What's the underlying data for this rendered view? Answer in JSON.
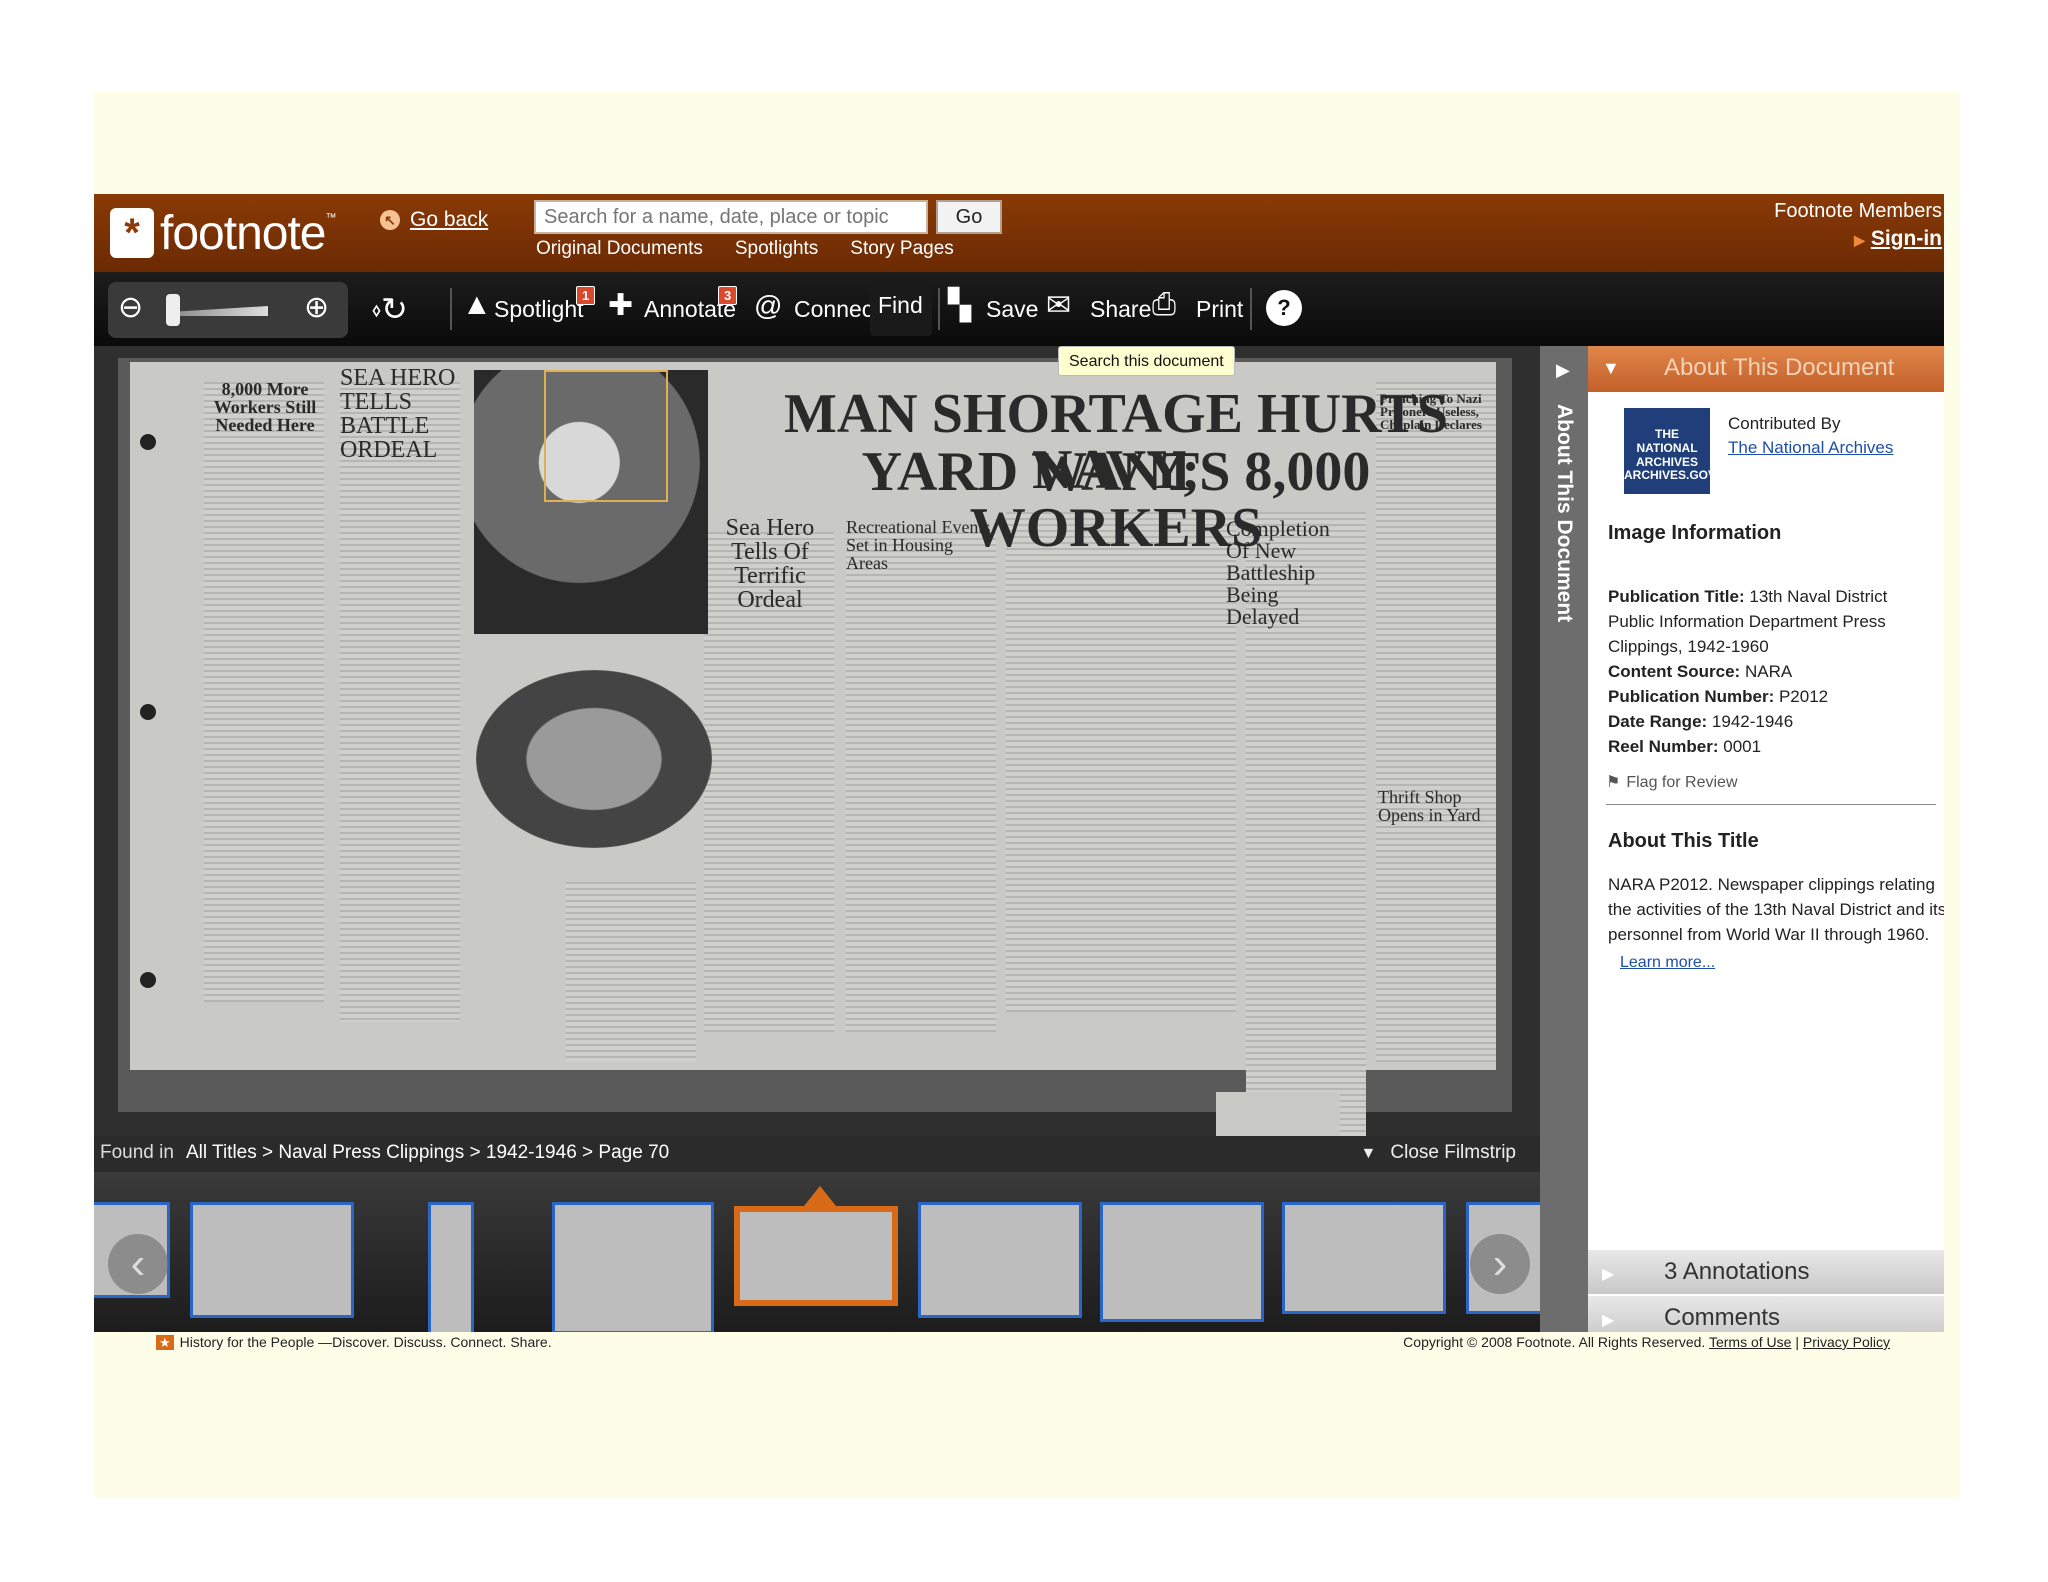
{
  "header": {
    "brand": "footnote",
    "tm": "™",
    "go_back": "Go back",
    "search_placeholder": "Search for a name, date, place or topic",
    "go_button": "Go",
    "nav": [
      "Original Documents",
      "Spotlights",
      "Story Pages"
    ],
    "members_label": "Footnote Members",
    "sign_in": "Sign-in"
  },
  "toolbar": {
    "spotlight": "Spotlight",
    "spotlight_count": "1",
    "annotate": "Annotate",
    "annotate_count": "3",
    "connect": "Connect",
    "find": "Find",
    "save": "Save",
    "share": "Share",
    "print": "Print",
    "help": "?",
    "tooltip": "Search this document"
  },
  "document": {
    "headline1": "MAN SHORTAGE HURTS NAVY;",
    "headline2": "YARD WANTS 8,000 WORKERS",
    "col1": "8,000 More Workers Still Needed Here",
    "col2": "SEA HERO TELLS BATTLE ORDEAL",
    "col3": "Sea Hero Tells Of Terrific Ordeal",
    "col4": "Recreational Events Set in Housing Areas",
    "col5": "Completion Of New Battleship Being Delayed",
    "col6": "Preaching To Nazi Prisoners Useless, Chaplain Declares",
    "col7": "Thrift Shop Opens in Yard"
  },
  "found_in": {
    "label": "Found in",
    "path": "All Titles > Naval Press Clippings > 1942-1946 > Page 70",
    "close_filmstrip": "Close Filmstrip"
  },
  "sidebar": {
    "vertical_tab": "About This Document",
    "section_title": "About This Document",
    "contributed_by": "Contributed By",
    "contributor": "The National Archives",
    "logo_text": "THE NATIONAL ARCHIVES ARCHIVES.GOV",
    "image_info_title": "Image Information",
    "fields": [
      {
        "label": "Publication Title:",
        "value": "13th Naval District Public Information Department Press Clippings, 1942-1960"
      },
      {
        "label": "Content Source:",
        "value": "NARA"
      },
      {
        "label": "Publication Number:",
        "value": "P2012"
      },
      {
        "label": "Date Range:",
        "value": "1942-1946"
      },
      {
        "label": "Reel Number:",
        "value": "0001"
      }
    ],
    "flag": "Flag for Review",
    "about_title": "About This Title",
    "about_text": "NARA P2012. Newspaper clippings relating the activities of the 13th Naval District and its personnel from World War II through 1960.",
    "learn_more": "Learn more...",
    "annotations": "3 Annotations",
    "comments": "Comments"
  },
  "footer": {
    "tagline": "History for the People —Discover. Discuss. Connect. Share.",
    "copyright": "Copyright © 2008 Footnote. All Rights Reserved.",
    "terms": "Terms of Use",
    "privacy": "Privacy Policy"
  },
  "colors": {
    "brand": "#8a3a06",
    "accent": "#d96a18",
    "thumb_border": "#2a66c8"
  }
}
